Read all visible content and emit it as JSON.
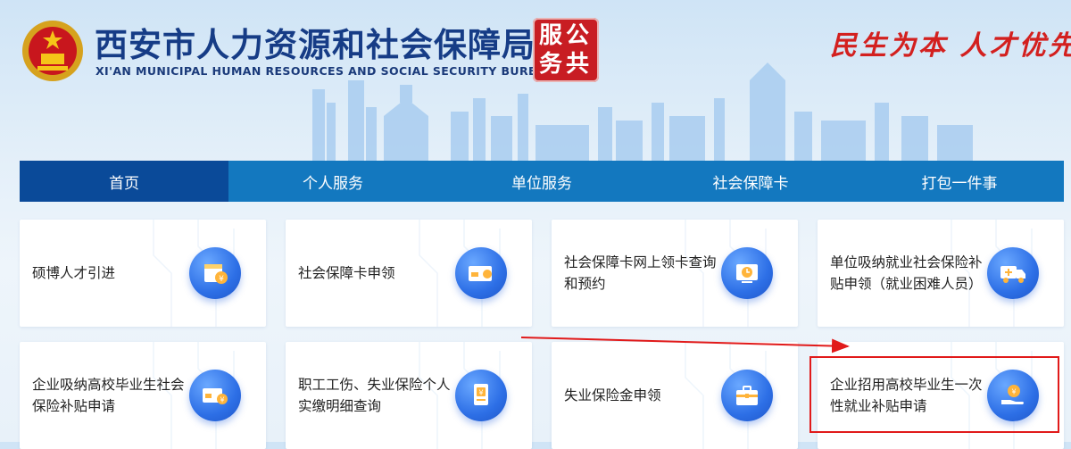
{
  "header": {
    "title_zh": "西安市人力资源和社会保障局",
    "title_en": "XI'AN MUNICIPAL HUMAN RESOURCES AND SOCIAL SECURITY BUREAU",
    "seal_line1": "服公",
    "seal_line2": "务共",
    "slogan": "民生为本 人才优先"
  },
  "nav": {
    "items": [
      {
        "label": "首页",
        "active": true
      },
      {
        "label": "个人服务"
      },
      {
        "label": "单位服务"
      },
      {
        "label": "社会保障卡"
      },
      {
        "label": "打包一件事"
      }
    ]
  },
  "cards": [
    {
      "label": "硕博人才引进",
      "icon": "calendar-yuan-icon"
    },
    {
      "label": "社会保障卡申领",
      "icon": "card-icon"
    },
    {
      "label": "社会保障卡网上领卡查询和预约",
      "icon": "clock-card-icon"
    },
    {
      "label": "单位吸纳就业社会保险补贴申领（就业困难人员）",
      "icon": "truck-icon"
    },
    {
      "label": "企业吸纳高校毕业生社会保险补贴申请",
      "icon": "card-yuan-icon"
    },
    {
      "label": "职工工伤、失业保险个人实缴明细查询",
      "icon": "document-yuan-icon"
    },
    {
      "label": "失业保险金申领",
      "icon": "briefcase-icon"
    },
    {
      "label": "企业招用高校毕业生一次性就业补贴申请",
      "icon": "hand-money-icon"
    }
  ],
  "colors": {
    "nav_bg": "#1378bf",
    "nav_active": "#0a4a99",
    "title": "#163c86",
    "seal": "#c81d23",
    "slogan": "#d3201f",
    "icon_blue": "#2d6fe6",
    "highlight": "#e11a1a"
  }
}
